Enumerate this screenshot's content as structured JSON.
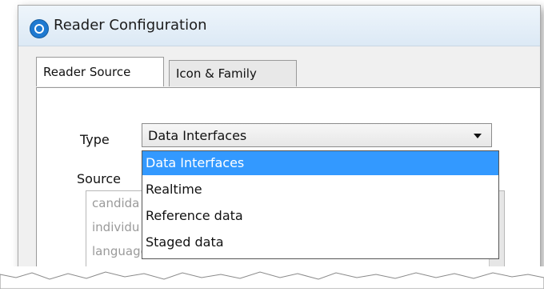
{
  "window": {
    "title": "Reader Configuration",
    "icon": "app-icon"
  },
  "tabs": [
    {
      "label": "Reader Source",
      "active": true
    },
    {
      "label": "Icon & Family",
      "active": false
    }
  ],
  "form": {
    "type_label": "Type",
    "type_value": "Data Interfaces",
    "source_label": "Source"
  },
  "dropdown_options": [
    "Data Interfaces",
    "Realtime",
    "Reference data",
    "Staged data"
  ],
  "source_list": [
    {
      "text": "candida",
      "visible_fragment": true
    },
    {
      "text": "individu",
      "visible_fragment": true
    },
    {
      "text": "languages (string)"
    }
  ],
  "colors": {
    "highlight": "#3399ff"
  }
}
